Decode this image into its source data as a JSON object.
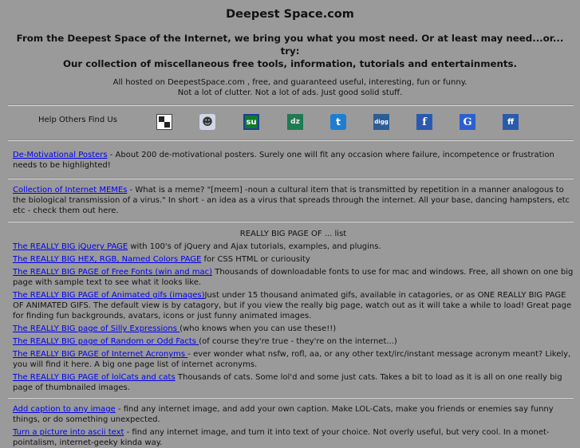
{
  "header": {
    "title": "Deepest Space.com",
    "intro_line1": "From the Deepest Space of the Internet, we bring you what you most need. Or at least may need...or... try:",
    "intro_line2": "Our collection of miscellaneous free tools, information, tutorials and entertainments.",
    "hosted_line1": "All hosted on DeepestSpace.com , free, and guaranteed useful, interesting, fun or funny.",
    "hosted_line2": "Not a lot of clutter. Not a lot of ads. Just good solid stuff."
  },
  "share": {
    "label": "Help Others Find Us",
    "icons": [
      {
        "name": "delicious-icon",
        "glyph": ""
      },
      {
        "name": "reddit-icon",
        "glyph": "☻"
      },
      {
        "name": "stumbleupon-icon",
        "glyph": "su"
      },
      {
        "name": "dzone-icon",
        "glyph": "dz"
      },
      {
        "name": "technorati-icon",
        "glyph": "t"
      },
      {
        "name": "digg-icon",
        "glyph": "digg"
      },
      {
        "name": "facebook-icon",
        "glyph": "f"
      },
      {
        "name": "google-icon",
        "glyph": "G"
      },
      {
        "name": "friendfeed-icon",
        "glyph": "ff"
      }
    ]
  },
  "sections": {
    "posters": {
      "link": "De-Motivational Posters",
      "text": " - About 200 de-motivational posters. Surely one will fit any occasion where failure, incompetence or frustration needs to be highlighted!"
    },
    "memes": {
      "link": "Collection of Internet MEMEs",
      "text": " - What is a meme? \"[meem] -noun a cultural item that is transmitted by repetition in a manner analogous to the biological transmission of a virus.\" In short - an idea as a virus that spreads through the internet. All your base, dancing hampsters, etc etc - check them out here."
    },
    "bigpage_heading": "REALLY BIG PAGE OF ... list",
    "bigpage_items": [
      {
        "link": "The REALLY BIG jQuery PAGE",
        "text": " with 100's of jQuery and Ajax tutorials, examples, and plugins."
      },
      {
        "link": "The REALLY BIG HEX, RGB, Named Colors PAGE",
        "text": " for CSS HTML or curiousity"
      },
      {
        "link": "The REALLY BIG PAGE of Free Fonts (win and mac)",
        "text": " Thousands of downloadable fonts to use for mac and windows. Free, all shown on one big page with sample text to see what it looks like."
      },
      {
        "link": "The REALLY BIG PAGE of Animated gifs (images)",
        "text": "Just under 15 thousand animated gifs, available in catagories, or as ONE REALLY BIG PAGE OF ANIMATED GIFS. The default view is by catagory, but if you view the really big page, watch out as it will take a while to load! Great page for finding fun backgrounds, avatars, icons or just funny animated images."
      },
      {
        "link": "The REALLY BIG page of Silly Expressions ",
        "text": "(who knows when you can use these!!)"
      },
      {
        "link": "The REALLY BIG page of Random or Odd Facts ",
        "text": "(of course they're true - they're on the internet...)"
      },
      {
        "link": "The REALLY BIG PAGE of Internet Acronyms ",
        "text": "- ever wonder what nsfw, rofl, aa, or any other text/irc/instant message acronym meant? Likely, you will find it here. A big one page list of internet acronyms."
      },
      {
        "link": "The REALLY BIG PAGE of lolCats and cats",
        "text": " Thousands of cats. Some lol'd and some just cats. Takes a bit to load as it is all on one really big page of thumbnailed images."
      }
    ],
    "tools": [
      {
        "link": "Add caption to any image",
        "text": " - find any internet image, and add your own caption. Make LOL-Cats, make you friends or enemies say funny things, or do something unexpected."
      },
      {
        "link": "Turn a picture into ascii text",
        "text": " - find any internet image, and turn it into text of your choice. Not overly useful, but very cool. In a monet-pointalism, internet-geeky kinda way."
      }
    ]
  }
}
